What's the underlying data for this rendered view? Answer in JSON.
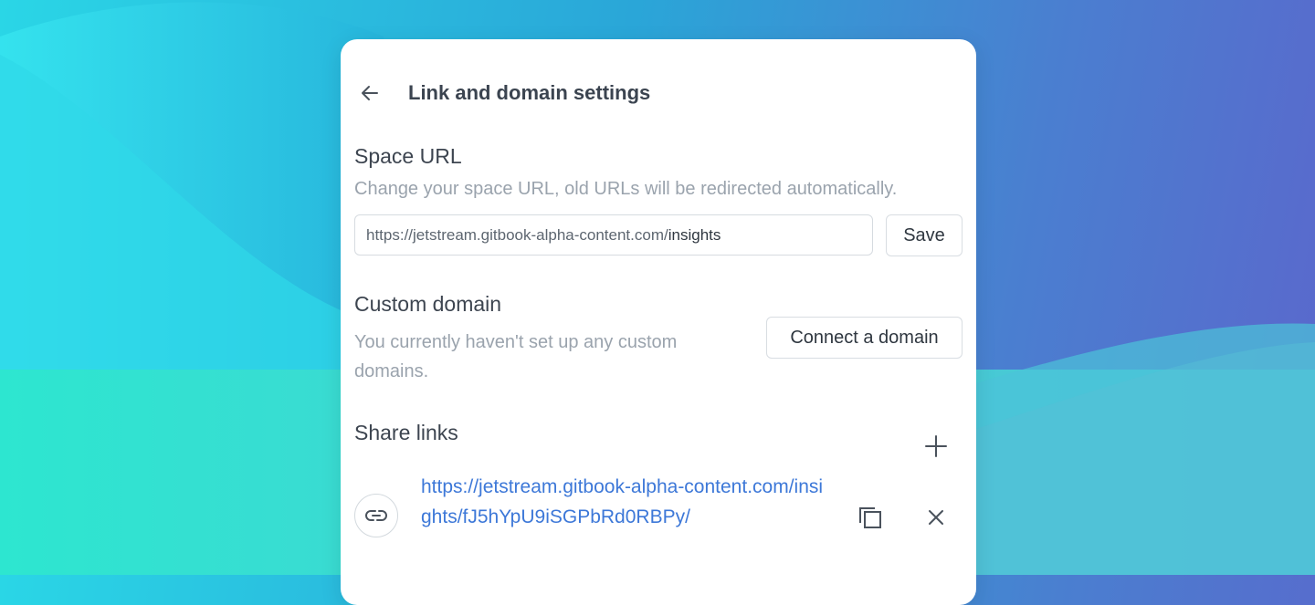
{
  "header": {
    "title": "Link and domain settings",
    "back_icon": "arrow-left-icon"
  },
  "space_url": {
    "title": "Space URL",
    "description": "Change your space URL, old URLs will be redirected automatically.",
    "url_prefix": "https://jetstream.gitbook-alpha-content.com/",
    "url_slug": "insights",
    "save_label": "Save"
  },
  "custom_domain": {
    "title": "Custom domain",
    "description": "You currently haven't set up any custom domains.",
    "connect_label": "Connect a domain"
  },
  "share_links": {
    "title": "Share links",
    "add_icon": "plus-icon",
    "items": [
      {
        "url": "https://jetstream.gitbook-alpha-content.com/insights/fJ5hYpU9iSGPbRd0RBPy/",
        "copy_icon": "copy-icon",
        "remove_icon": "close-icon"
      }
    ]
  },
  "colors": {
    "link": "#3d78d8",
    "title": "#3b4450",
    "muted": "#9aa3ad",
    "panel": "#ffffff"
  }
}
